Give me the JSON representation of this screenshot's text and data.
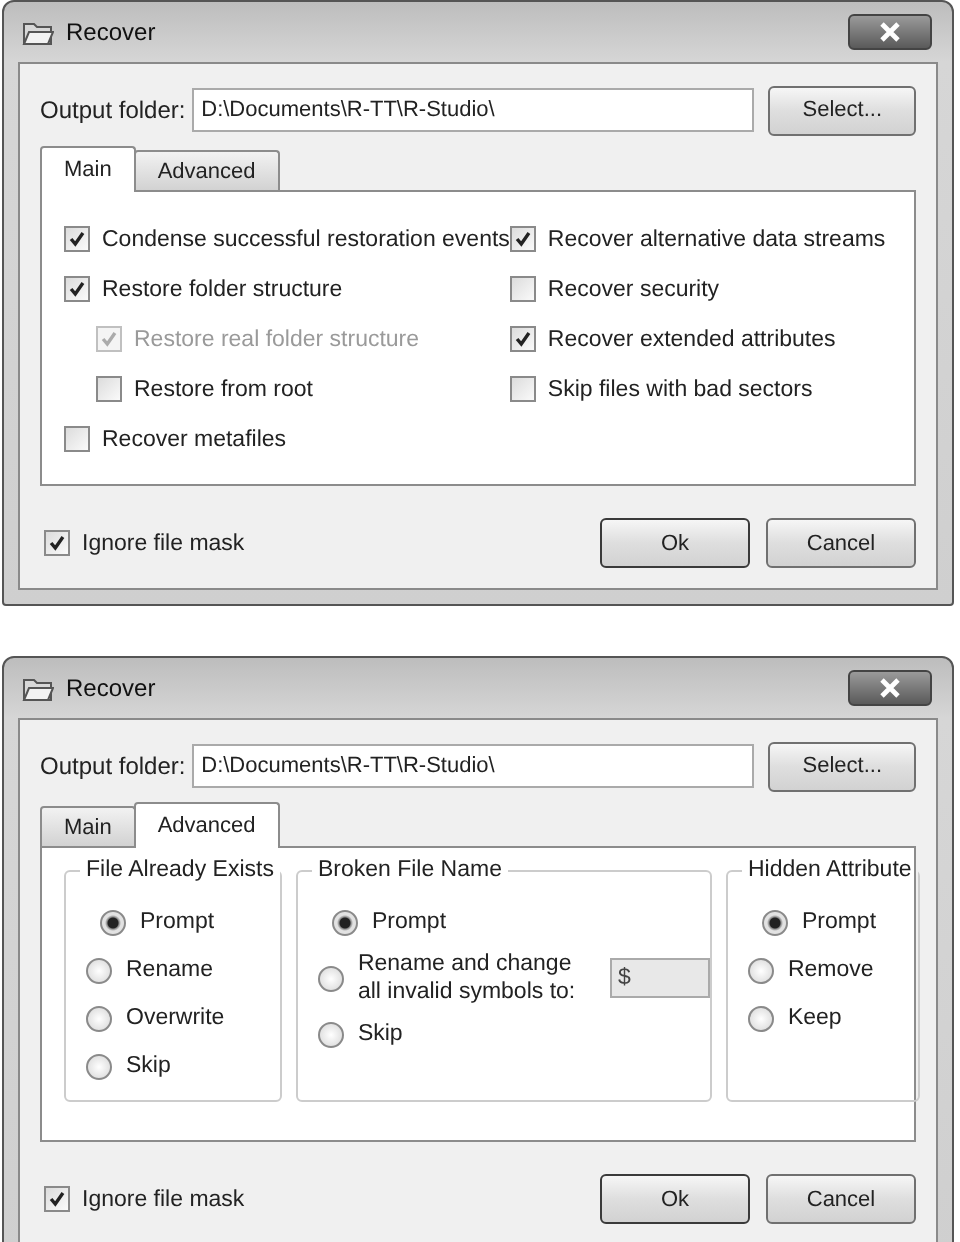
{
  "dialogs": [
    {
      "title": "Recover",
      "output_label": "Output folder:",
      "output_value": "D:\\Documents\\R-TT\\R-Studio\\",
      "select_button": "Select...",
      "tabs": [
        {
          "label": "Main",
          "selected": true
        },
        {
          "label": "Advanced",
          "selected": false
        }
      ],
      "panel": {
        "kind": "checkboxes",
        "columns": [
          [
            {
              "label": "Condense successful restoration events",
              "checked": true,
              "disabled": false
            },
            {
              "label": "Restore folder structure",
              "checked": true,
              "disabled": false,
              "children": [
                {
                  "label": "Restore real folder structure",
                  "checked": true,
                  "disabled": true
                },
                {
                  "label": "Restore from root",
                  "checked": false,
                  "disabled": false
                }
              ]
            },
            {
              "label": "Recover metafiles",
              "checked": false,
              "disabled": false
            }
          ],
          [
            {
              "label": "Recover alternative data streams",
              "checked": true,
              "disabled": false
            },
            {
              "label": "Recover security",
              "checked": false,
              "disabled": false
            },
            {
              "label": "Recover extended attributes",
              "checked": true,
              "disabled": false
            },
            {
              "label": "Skip files with bad sectors",
              "checked": false,
              "disabled": false
            }
          ]
        ]
      },
      "ignore_mask": {
        "label": "Ignore file mask",
        "checked": true
      },
      "buttons": [
        "Ok",
        "Cancel"
      ]
    },
    {
      "title": "Recover",
      "output_label": "Output folder:",
      "output_value": "D:\\Documents\\R-TT\\R-Studio\\",
      "select_button": "Select...",
      "tabs": [
        {
          "label": "Main",
          "selected": false
        },
        {
          "label": "Advanced",
          "selected": true
        }
      ],
      "panel": {
        "kind": "radio_groups",
        "groups": [
          {
            "title": "File Already Exists",
            "options": [
              {
                "label": "Prompt",
                "selected": true
              },
              {
                "label": "Rename",
                "selected": false
              },
              {
                "label": "Overwrite",
                "selected": false
              },
              {
                "label": "Skip",
                "selected": false
              }
            ]
          },
          {
            "title": "Broken File Name",
            "options": [
              {
                "label": "Prompt",
                "selected": true
              },
              {
                "label": "Rename and change all invalid symbols to:",
                "selected": false,
                "field": {
                  "value": "$",
                  "disabled": true
                }
              },
              {
                "label": "Skip",
                "selected": false
              }
            ]
          },
          {
            "title": "Hidden Attribute",
            "options": [
              {
                "label": "Prompt",
                "selected": true
              },
              {
                "label": "Remove",
                "selected": false
              },
              {
                "label": "Keep",
                "selected": false
              }
            ]
          }
        ]
      },
      "ignore_mask": {
        "label": "Ignore file mask",
        "checked": true
      },
      "buttons": [
        "Ok",
        "Cancel"
      ]
    }
  ]
}
